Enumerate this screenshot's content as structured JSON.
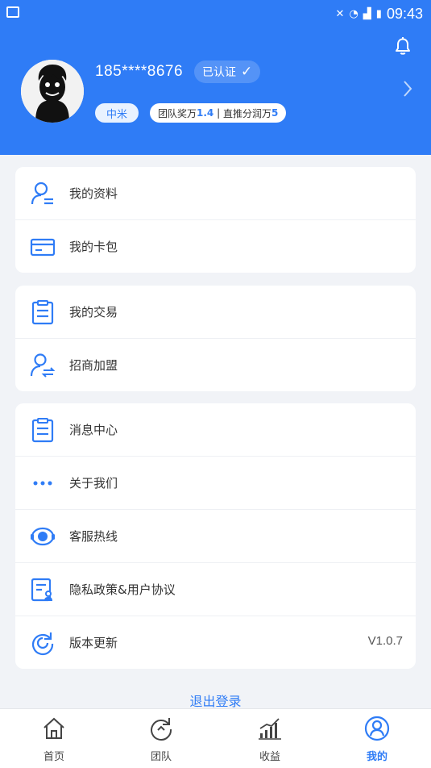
{
  "status_bar": {
    "time": "09:43"
  },
  "profile": {
    "phone": "185****8676",
    "verified_label": "已认证",
    "level": "中米",
    "stats": {
      "team_prefix": "团队奖万",
      "team_value": "1.4",
      "separator": " | ",
      "direct_prefix": "直推分润万",
      "direct_value": "5"
    }
  },
  "menu_groups": [
    {
      "items": [
        {
          "label": "我的资料",
          "icon": "profile-icon"
        },
        {
          "label": "我的卡包",
          "icon": "card-wallet-icon"
        }
      ]
    },
    {
      "items": [
        {
          "label": "我的交易",
          "icon": "clipboard-icon"
        },
        {
          "label": "招商加盟",
          "icon": "user-exchange-icon"
        }
      ]
    },
    {
      "items": [
        {
          "label": "消息中心",
          "icon": "message-icon"
        },
        {
          "label": "关于我们",
          "icon": "more-dots-icon"
        },
        {
          "label": "客服热线",
          "icon": "headset-icon"
        },
        {
          "label": "隐私政策&用户协议",
          "icon": "document-user-icon"
        },
        {
          "label": "版本更新",
          "icon": "refresh-icon",
          "value": "V1.0.7"
        }
      ]
    }
  ],
  "logout_label": "退出登录",
  "tabs": [
    {
      "label": "首页",
      "icon": "home-icon"
    },
    {
      "label": "团队",
      "icon": "team-refresh-icon"
    },
    {
      "label": "收益",
      "icon": "bar-chart-icon"
    },
    {
      "label": "我的",
      "icon": "user-circle-icon",
      "active": true
    }
  ],
  "colors": {
    "primary": "#2f7cf6",
    "background": "#f1f3f7"
  }
}
